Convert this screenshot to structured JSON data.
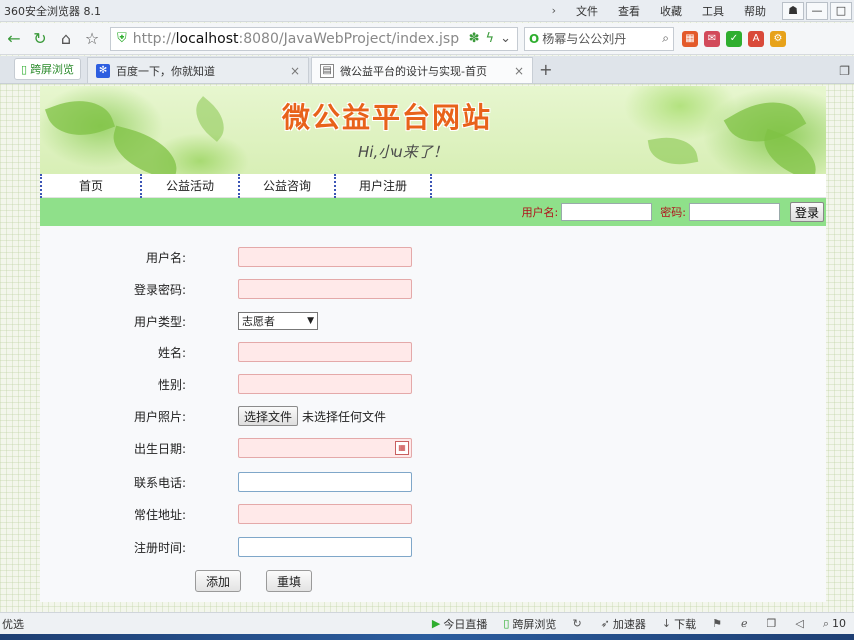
{
  "browser": {
    "app_title": "360安全浏览器 8.1",
    "menu": [
      "文件",
      "查看",
      "收藏",
      "工具",
      "帮助"
    ],
    "url_prefix": "http://",
    "url_host": "localhost",
    "url_rest": ":8080/JavaWebProject/index.jsp",
    "search_text": "杨幂与公公刘丹",
    "tab_pill_label": "跨屏浏览",
    "tabs": [
      {
        "title": "百度一下，你就知道",
        "active": false
      },
      {
        "title": "微公益平台的设计与实现-首页",
        "active": true
      }
    ],
    "new_tab": "+",
    "status_left": "优选",
    "status_items": [
      "今日直播",
      "跨屏浏览",
      "加速器",
      "下载",
      "10"
    ]
  },
  "site": {
    "banner_title": "微公益平台网站",
    "banner_subtitle": "Hi,小u来了！",
    "nav": [
      "首页",
      "公益活动",
      "公益咨询",
      "用户注册"
    ],
    "login": {
      "username_label": "用户名:",
      "password_label": "密码:",
      "login_button": "登录"
    }
  },
  "form": {
    "username_label": "用户名:",
    "password_label": "登录密码:",
    "usertype_label": "用户类型:",
    "usertype_value": "志愿者",
    "name_label": "姓名:",
    "gender_label": "性别:",
    "photo_label": "用户照片:",
    "photo_button": "选择文件",
    "photo_status": "未选择任何文件",
    "birthday_label": "出生日期:",
    "phone_label": "联系电话:",
    "address_label": "常住地址:",
    "regtime_label": "注册时间:",
    "add_button": "添加",
    "reset_button": "重填"
  },
  "colors": {
    "login_bar": "#8fe08a",
    "required_field_bg": "#ffe9e9",
    "banner_title": "#e8621a",
    "login_label": "#b0101a"
  }
}
